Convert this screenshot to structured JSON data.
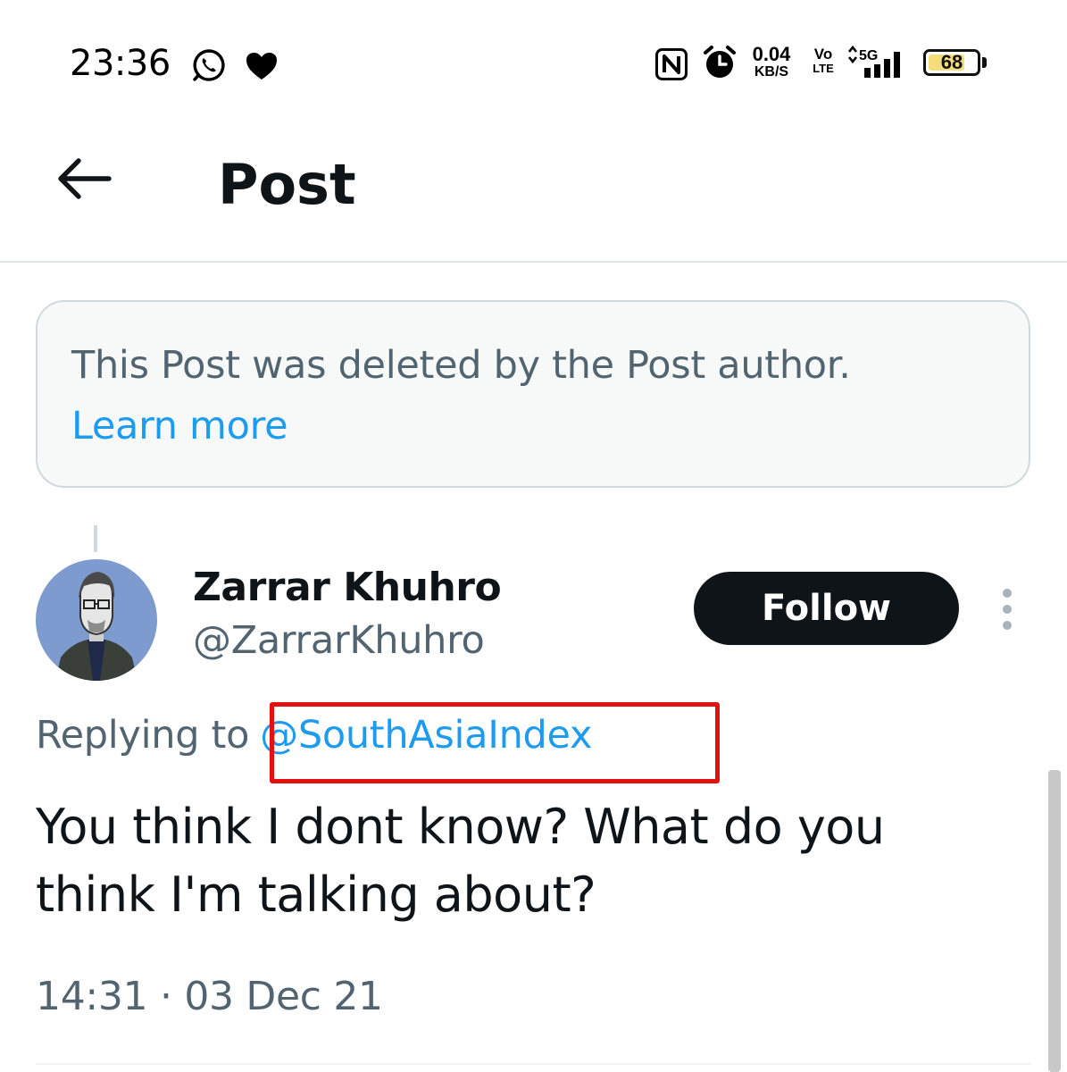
{
  "status_bar": {
    "time": "23:36",
    "icons": [
      "whatsapp-icon",
      "heart-icon",
      "nfc-icon",
      "alarm-icon",
      "signal-icon",
      "battery-icon"
    ],
    "net_speed_value": "0.04",
    "net_speed_unit": "KB/S",
    "volte_top": "Vo",
    "volte_bottom": "LTE",
    "network_type": "5G",
    "battery_level": "68"
  },
  "header": {
    "title": "Post",
    "back_icon": "arrow-left-icon"
  },
  "notice": {
    "text": "This Post was deleted by the Post author.",
    "link": "Learn more"
  },
  "post": {
    "author_name": "Zarrar Khuhro",
    "author_handle": "@ZarrarKhuhro",
    "follow_label": "Follow",
    "more_icon": "more-vertical-icon",
    "replying_prefix": "Replying to",
    "replying_handle": "@SouthAsiaIndex",
    "text": "You think I dont know? What do you think I'm talking about?",
    "timestamp": "14:31 · 03 Dec 21"
  },
  "colors": {
    "link": "#1d9bf0",
    "secondary_text": "#536471",
    "primary_text": "#0f1419",
    "highlight_box": "#e31010",
    "battery_fill": "#f5dd7a"
  }
}
